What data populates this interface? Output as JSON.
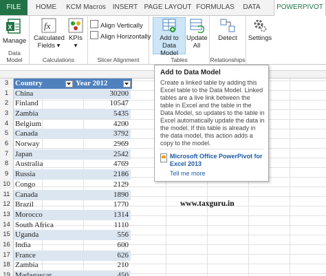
{
  "tabs": [
    "FILE",
    "HOME",
    "KCM Macros",
    "INSERT",
    "PAGE LAYOUT",
    "FORMULAS",
    "DATA",
    "POWERPIVOT"
  ],
  "ribbon": {
    "data_model": {
      "manage": "Manage",
      "label": "Data Model"
    },
    "calculations": {
      "calculated_fields": "Calculated Fields",
      "kpis": "KPIs",
      "label": "Calculations"
    },
    "slicer_alignment": {
      "align_vertically": "Align Vertically",
      "align_horizontally": "Align Horizontally",
      "label": "Slicer Alignment"
    },
    "tables": {
      "add_to_data_model": "Add to Data Model",
      "update_all": "Update All",
      "label": "Tables"
    },
    "relationships": {
      "detect": "Detect",
      "label": "Relationships"
    },
    "settings": "Settings"
  },
  "table": {
    "headers": [
      "Country",
      "Year 2012"
    ],
    "header_row": "3",
    "rows": [
      {
        "row": "1",
        "country": "China",
        "value": "30200"
      },
      {
        "row": "2",
        "country": "Finland",
        "value": "10547"
      },
      {
        "row": "3",
        "country": "Zambia",
        "value": "5435"
      },
      {
        "row": "4",
        "country": "Belgium",
        "value": "4200"
      },
      {
        "row": "5",
        "country": "Canada",
        "value": "3792"
      },
      {
        "row": "6",
        "country": "Norway",
        "value": "2969"
      },
      {
        "row": "7",
        "country": "Japan",
        "value": "2542"
      },
      {
        "row": "8",
        "country": "Australia",
        "value": "4769"
      },
      {
        "row": "9",
        "country": "Russia",
        "value": "2186"
      },
      {
        "row": "10",
        "country": "Congo",
        "value": "2129"
      },
      {
        "row": "11",
        "country": "Canada",
        "value": "1890"
      },
      {
        "row": "12",
        "country": "Brazil",
        "value": "1770"
      },
      {
        "row": "13",
        "country": "Morocco",
        "value": "1314"
      },
      {
        "row": "14",
        "country": "South Africa",
        "value": "1110"
      },
      {
        "row": "15",
        "country": "Uganda",
        "value": "556"
      },
      {
        "row": "16",
        "country": "India",
        "value": "600"
      },
      {
        "row": "17",
        "country": "France",
        "value": "626"
      },
      {
        "row": "18",
        "country": "Zambia",
        "value": "210"
      },
      {
        "row": "19",
        "country": "Madagascar",
        "value": "450"
      }
    ]
  },
  "tooltip": {
    "title": "Add to Data Model",
    "body": "Create a linked table by adding this Excel table to the Data Model. Linked tables are a live link between the table in Excel and the table in the Data Model, so updates to the table in Excel automatically update the data in the model. If this table is already in the data model, this action adds a copy to the model.",
    "link": "Microsoft Office PowerPivot for Excel 2013",
    "help": "Tell me more"
  },
  "watermark": "www.taxguru.in"
}
